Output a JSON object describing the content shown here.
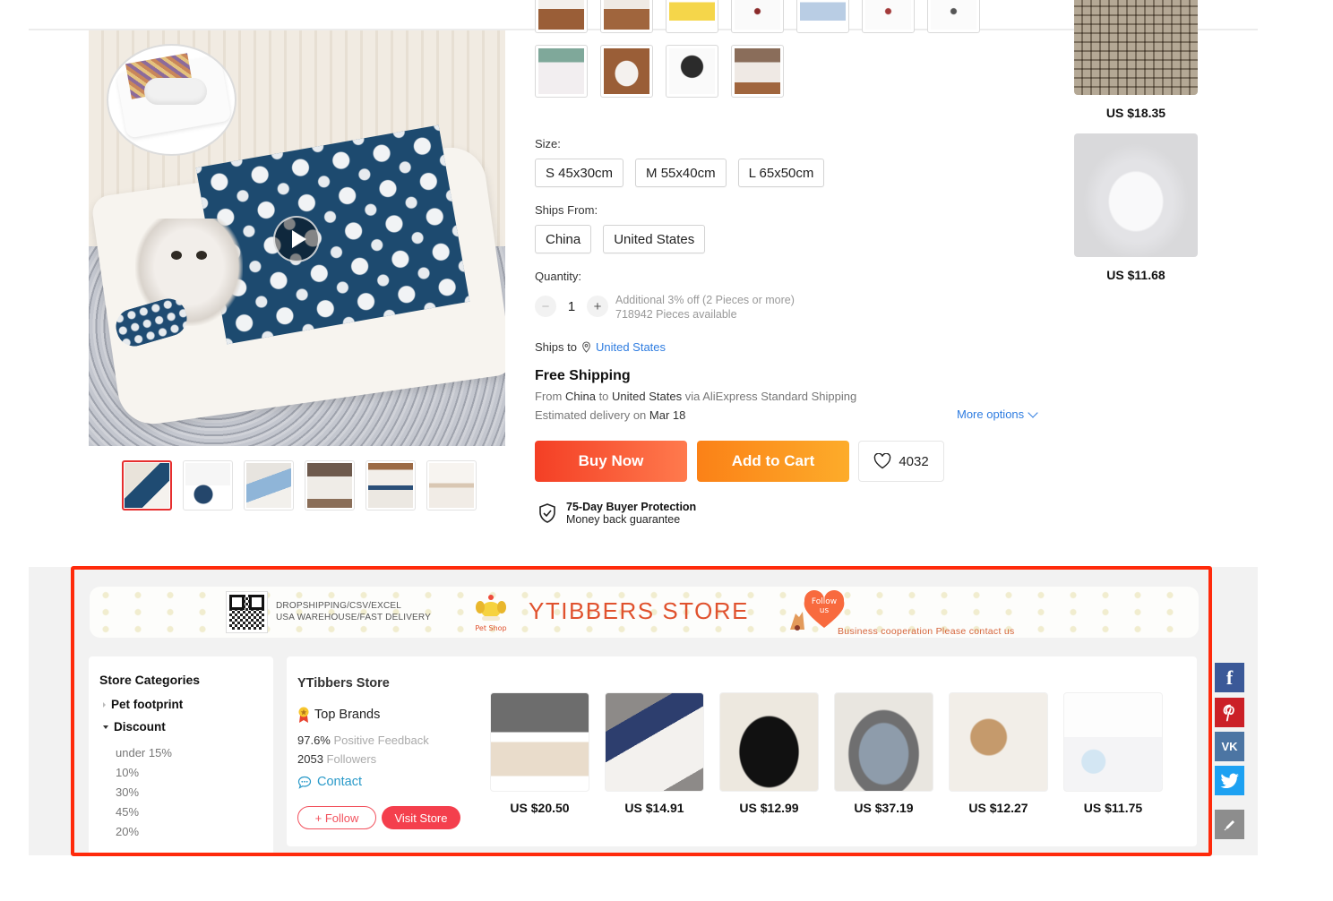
{
  "gallery": {
    "main_image_alt": "Cat sleeping bag with navy cat-pattern quilt",
    "video_play_label": "Play video",
    "thumbnails": [
      {
        "label": "Thumbnail 1 (video)",
        "active": true
      },
      {
        "label": "Thumbnail 2"
      },
      {
        "label": "Thumbnail 3"
      },
      {
        "label": "Thumbnail 4"
      },
      {
        "label": "Thumbnail 5"
      },
      {
        "label": "Thumbnail 6 - size chart"
      }
    ]
  },
  "color_swatches": {
    "row1_count": 7,
    "row2_count": 4
  },
  "size": {
    "label": "Size:",
    "options": [
      "S 45x30cm",
      "M 55x40cm",
      "L 65x50cm"
    ]
  },
  "ships_from": {
    "label": "Ships From:",
    "options": [
      "China",
      "United States"
    ]
  },
  "quantity": {
    "label": "Quantity:",
    "value": "1",
    "minus": "−",
    "plus": "+",
    "discount_note": "Additional 3% off (2 Pieces or more)",
    "available": "718942 Pieces available"
  },
  "ships_to": {
    "label": "Ships to",
    "country": "United States"
  },
  "shipping": {
    "title": "Free Shipping",
    "from_prefix": "From",
    "from": "China",
    "to_prefix": "to",
    "to": "United States",
    "via": "via AliExpress Standard Shipping",
    "delivery_prefix": "Estimated delivery on",
    "delivery_date": "Mar 18",
    "more_options": "More options"
  },
  "actions": {
    "buy_now": "Buy Now",
    "add_to_cart": "Add to Cart",
    "wishlist_count": "4032"
  },
  "protection": {
    "title": "75-Day Buyer Protection",
    "subtitle": "Money back guarantee"
  },
  "recommendations": [
    {
      "price": "US $18.35"
    },
    {
      "price": "US $11.68"
    }
  ],
  "store_banner": {
    "line1": "DROPSHIPPING/CSV/EXCEL",
    "line2": "USA WAREHOUSE/FAST DELIVERY",
    "logo_text": "Pet Shop",
    "title": "YTIBBERS STORE",
    "follow_heart": "Follow us",
    "business": "Business cooperation Please contact us"
  },
  "store_categories": {
    "title": "Store Categories",
    "items": [
      {
        "label": "Pet footprint",
        "expanded": false
      },
      {
        "label": "Discount",
        "expanded": true,
        "children": [
          "under 15%",
          "10%",
          "30%",
          "45%",
          "20%"
        ]
      }
    ]
  },
  "store": {
    "name": "YTibbers Store",
    "badge": "Top Brands",
    "feedback_value": "97.6%",
    "feedback_label": "Positive Feedback",
    "followers_value": "2053",
    "followers_label": "Followers",
    "contact": "Contact",
    "follow": "+ Follow",
    "visit": "Visit Store",
    "products": [
      {
        "price": "US $20.50"
      },
      {
        "price": "US $14.91"
      },
      {
        "price": "US $12.99"
      },
      {
        "price": "US $37.19"
      },
      {
        "price": "US $12.27"
      },
      {
        "price": "US $11.75"
      }
    ]
  },
  "social": {
    "facebook": "f",
    "pinterest": "P",
    "vk": "VK",
    "twitter": "twitter",
    "edit": "edit"
  },
  "colors": {
    "accent_red": "#f43f25",
    "accent_orange": "#fb8117",
    "link_blue": "#2e7ce0",
    "highlight_box": "#ff2a0b",
    "store_title": "#e0522e"
  }
}
